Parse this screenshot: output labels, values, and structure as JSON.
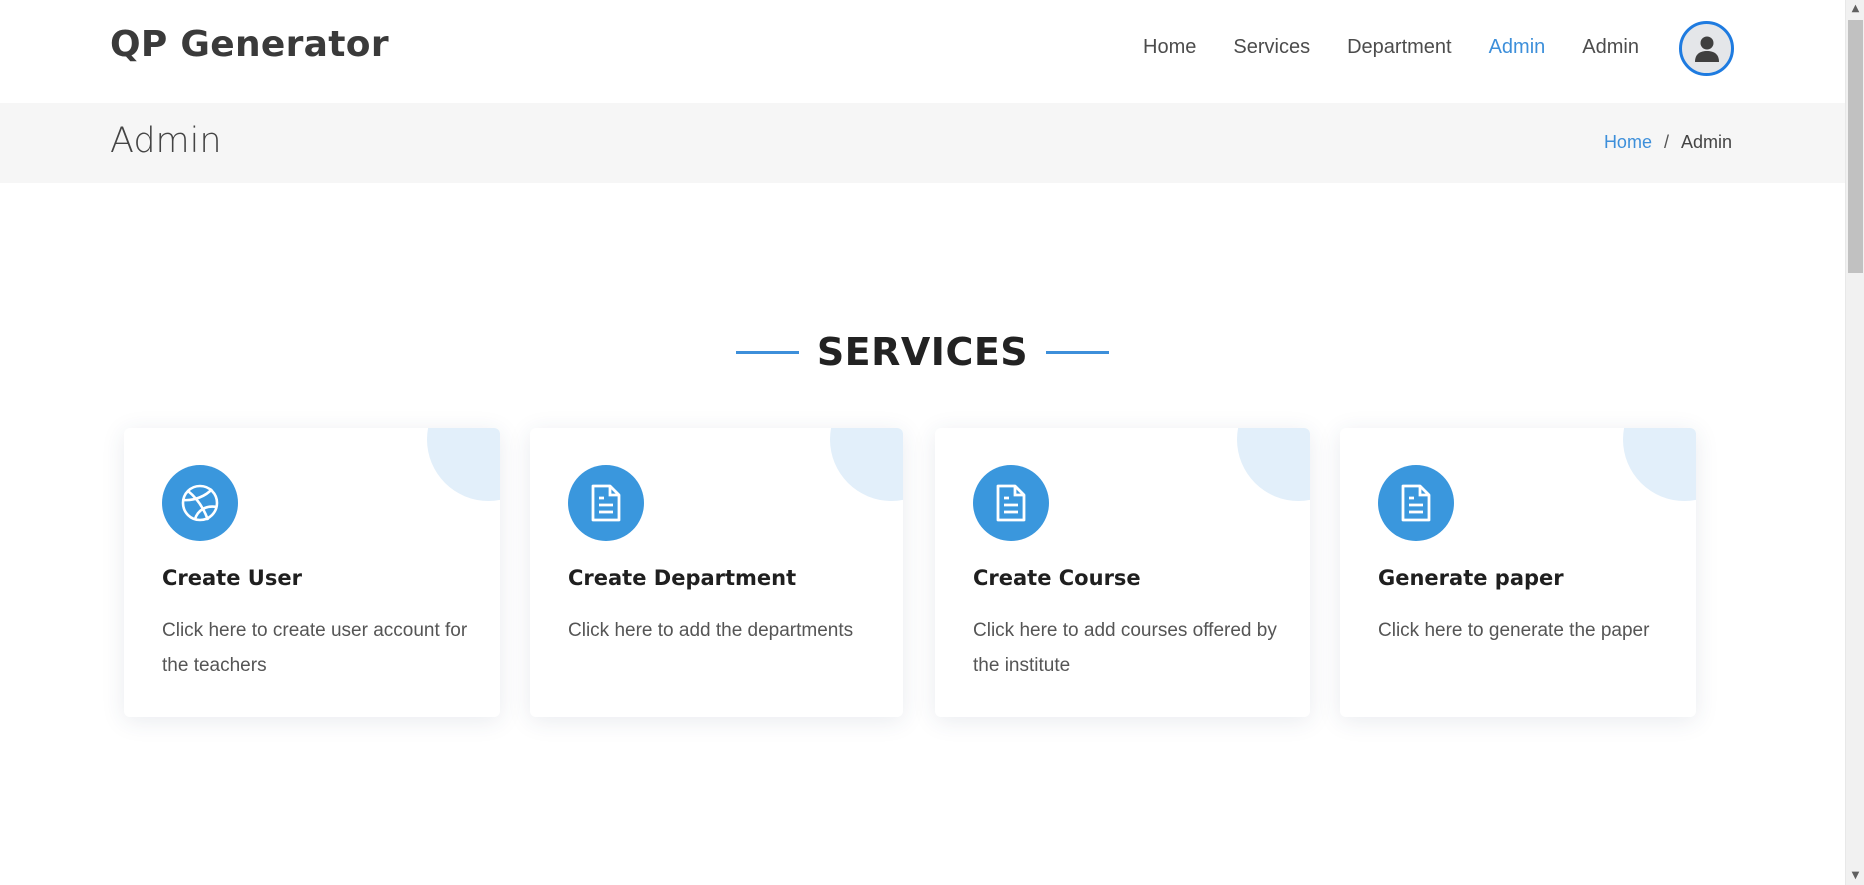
{
  "header": {
    "logo": "QP Generator",
    "nav": [
      {
        "label": "Home",
        "active": false
      },
      {
        "label": "Services",
        "active": false
      },
      {
        "label": "Department",
        "active": false
      },
      {
        "label": "Admin",
        "active": true
      },
      {
        "label": "Admin",
        "active": false
      }
    ],
    "avatar_icon": "user-icon"
  },
  "page": {
    "title": "Admin",
    "breadcrumb": {
      "home": "Home",
      "separator": "/",
      "current": "Admin"
    }
  },
  "services": {
    "heading": "SERVICES",
    "cards": [
      {
        "title": "Create User",
        "description": "Click here to create user account for the teachers",
        "icon": "dribbble-icon"
      },
      {
        "title": "Create Department",
        "description": "Click here to add the departments",
        "icon": "document-icon"
      },
      {
        "title": "Create Course",
        "description": "Click here to add courses offered by the institute",
        "icon": "document-icon"
      },
      {
        "title": "Generate paper",
        "description": "Click here to generate the paper",
        "icon": "document-icon"
      }
    ]
  },
  "colors": {
    "accent": "#3d8fda",
    "icon_bg": "#3a97dd",
    "corner_bg": "#e2effa",
    "avatar_border": "#1e7be0",
    "crumbbar_bg": "#f6f6f6"
  }
}
